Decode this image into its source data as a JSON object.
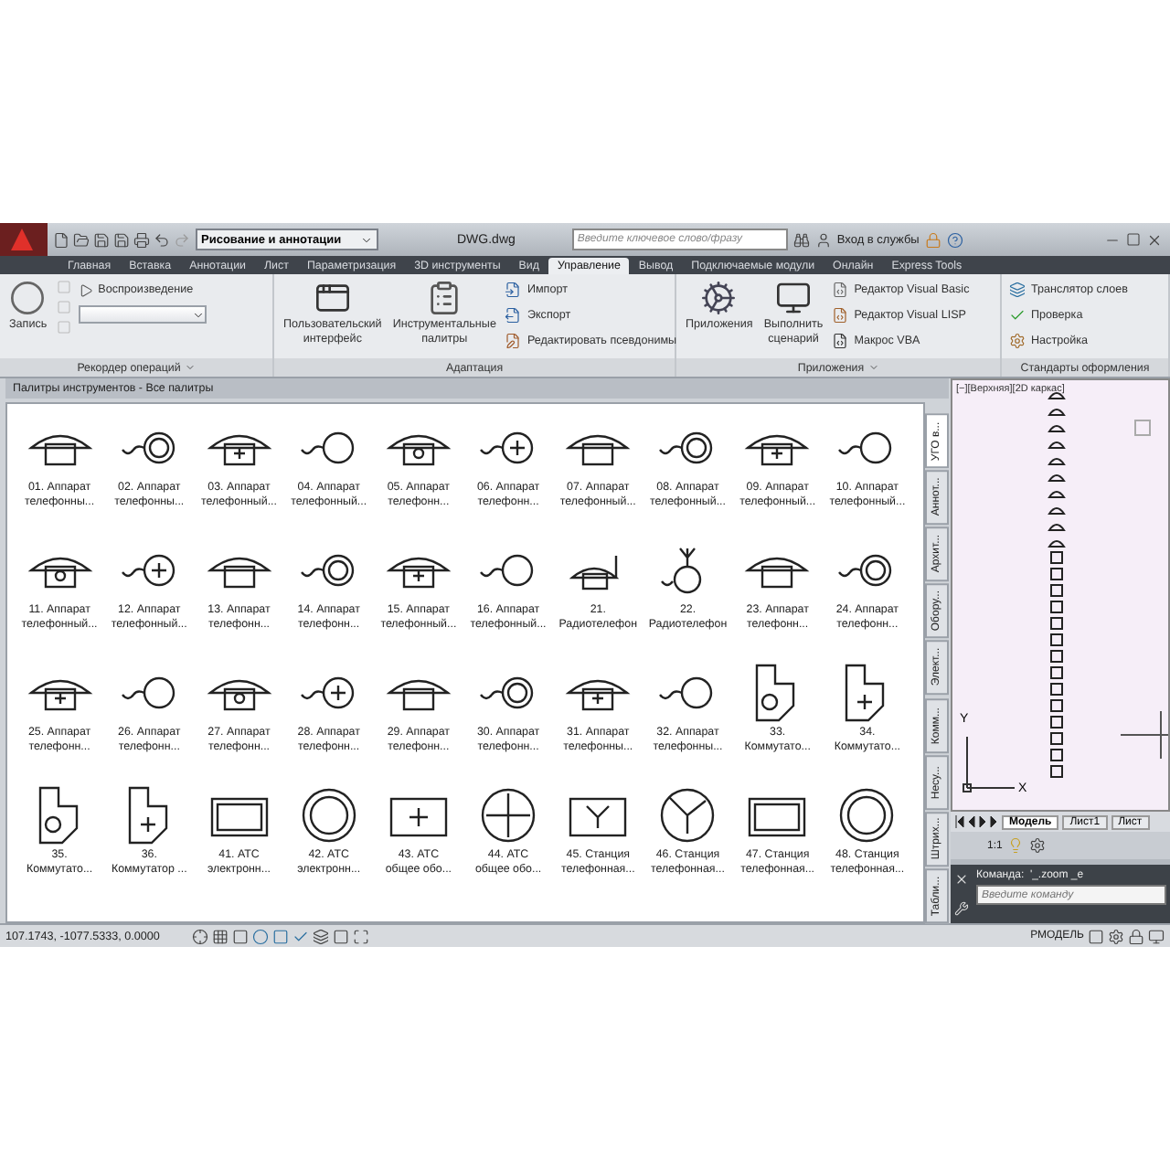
{
  "title_bar": {
    "workspace": "Рисование и аннотации",
    "title": "DWG.dwg",
    "search": {
      "placeholder": "Введите ключевое слово/фразу"
    },
    "sign_in": "Вход в службы"
  },
  "ribbon_tabs": [
    {
      "label": "Главная",
      "selected": false
    },
    {
      "label": "Вставка",
      "selected": false
    },
    {
      "label": "Аннотации",
      "selected": false
    },
    {
      "label": "Лист",
      "selected": false
    },
    {
      "label": "Параметризация",
      "selected": false
    },
    {
      "label": "3D инструменты",
      "selected": false
    },
    {
      "label": "Вид",
      "selected": false
    },
    {
      "label": "Управление",
      "selected": true
    },
    {
      "label": "Вывод",
      "selected": false
    },
    {
      "label": "Подключаемые модули",
      "selected": false
    },
    {
      "label": "Онлайн",
      "selected": false
    },
    {
      "label": "Express Tools",
      "selected": false
    }
  ],
  "ribbon_groups": [
    {
      "title": "Рекордер операций",
      "menu": true,
      "large": [
        {
          "lines": [
            "Запись"
          ]
        }
      ],
      "small": [
        {
          "kind": "play",
          "label": "Воспроизведение"
        },
        {
          "kind": "dropdown"
        }
      ]
    },
    {
      "title": "Адаптация",
      "menu": false,
      "large": [
        {
          "lines": [
            "Пользовательский",
            "интерфейс"
          ]
        },
        {
          "lines": [
            "Инструментальные",
            "палитры"
          ]
        }
      ],
      "small": [
        {
          "kind": "tool",
          "label": "Импорт"
        },
        {
          "kind": "tool",
          "label": "Экспорт"
        },
        {
          "kind": "tool",
          "label": "Редактировать псевдонимы"
        }
      ]
    },
    {
      "title": "Приложения",
      "menu": true,
      "large": [
        {
          "lines": [
            "Приложения"
          ]
        },
        {
          "lines": [
            "Выполнить",
            "сценарий"
          ]
        }
      ],
      "small": [
        {
          "kind": "tool",
          "label": "Редактор Visual Basic"
        },
        {
          "kind": "tool",
          "label": "Редактор Visual LISP"
        },
        {
          "kind": "tool",
          "label": "Макрос VBA"
        }
      ]
    },
    {
      "title": "Стандарты оформления",
      "menu": false,
      "small": [
        {
          "kind": "tool",
          "label": "Транслятор  слоев"
        },
        {
          "kind": "tool",
          "label": "Проверка"
        },
        {
          "kind": "tool",
          "label": "Настройка"
        }
      ]
    }
  ],
  "palette": {
    "title": "Палитры инструментов - Все палитры",
    "items": [
      {
        "kind": "phone",
        "lines": [
          "01. Аппарат",
          "телефонны..."
        ]
      },
      {
        "kind": "handset",
        "lines": [
          "02. Аппарат",
          "телефонны..."
        ]
      },
      {
        "kind": "phone",
        "lines": [
          "03. Аппарат",
          "телефонный..."
        ]
      },
      {
        "kind": "handset",
        "lines": [
          "04. Аппарат",
          "телефонный..."
        ]
      },
      {
        "kind": "phone",
        "lines": [
          "05. Аппарат",
          "телефонн..."
        ]
      },
      {
        "kind": "handset",
        "lines": [
          "06. Аппарат",
          "телефонн..."
        ]
      },
      {
        "kind": "phone",
        "lines": [
          "07. Аппарат",
          "телефонный..."
        ]
      },
      {
        "kind": "handset",
        "lines": [
          "08. Аппарат",
          "телефонный..."
        ]
      },
      {
        "kind": "phone",
        "lines": [
          "09. Аппарат",
          "телефонный..."
        ]
      },
      {
        "kind": "handset",
        "lines": [
          "10. Аппарат",
          "телефонный..."
        ]
      },
      {
        "kind": "phone",
        "lines": [
          "11. Аппарат",
          "телефонный..."
        ]
      },
      {
        "kind": "handset",
        "lines": [
          "12. Аппарат",
          "телефонный..."
        ]
      },
      {
        "kind": "phone",
        "lines": [
          "13. Аппарат",
          "телефонн..."
        ]
      },
      {
        "kind": "handset",
        "lines": [
          "14. Аппарат",
          "телефонн..."
        ]
      },
      {
        "kind": "phone",
        "lines": [
          "15. Аппарат",
          "телефонный..."
        ]
      },
      {
        "kind": "handset",
        "lines": [
          "16. Аппарат",
          "телефонный..."
        ]
      },
      {
        "kind": "radio",
        "lines": [
          "21.",
          "Радиотелефон"
        ]
      },
      {
        "kind": "radio-handset",
        "lines": [
          "22.",
          "Радиотелефон"
        ]
      },
      {
        "kind": "phone",
        "lines": [
          "23. Аппарат",
          "телефонн..."
        ]
      },
      {
        "kind": "handset",
        "lines": [
          "24. Аппарат",
          "телефонн..."
        ]
      },
      {
        "kind": "phone",
        "lines": [
          "25. Аппарат",
          "телефонн..."
        ]
      },
      {
        "kind": "handset",
        "lines": [
          "26. Аппарат",
          "телефонн..."
        ]
      },
      {
        "kind": "phone",
        "lines": [
          "27. Аппарат",
          "телефонн..."
        ]
      },
      {
        "kind": "handset",
        "lines": [
          "28. Аппарат",
          "телефонн..."
        ]
      },
      {
        "kind": "phone",
        "lines": [
          "29. Аппарат",
          "телефонн..."
        ]
      },
      {
        "kind": "handset",
        "lines": [
          "30. Аппарат",
          "телефонн..."
        ]
      },
      {
        "kind": "phone",
        "lines": [
          "31. Аппарат",
          "телефонны..."
        ]
      },
      {
        "kind": "handset",
        "lines": [
          "32. Аппарат",
          "телефонны..."
        ]
      },
      {
        "kind": "switch",
        "lines": [
          "33.",
          "Коммутато..."
        ]
      },
      {
        "kind": "switch",
        "lines": [
          "34.",
          "Коммутато..."
        ]
      },
      {
        "kind": "switch",
        "lines": [
          "35.",
          "Коммутато..."
        ]
      },
      {
        "kind": "switch",
        "lines": [
          "36.",
          "Коммутатор ..."
        ]
      },
      {
        "kind": "rect",
        "lines": [
          "41. АТС",
          "электронн..."
        ]
      },
      {
        "kind": "circle",
        "lines": [
          "42. АТС",
          "электронн..."
        ]
      },
      {
        "kind": "rect",
        "lines": [
          "43. АТС",
          "общее обо..."
        ]
      },
      {
        "kind": "circle",
        "lines": [
          "44. АТС",
          "общее обо..."
        ]
      },
      {
        "kind": "rect",
        "lines": [
          "45. Станция",
          "телефонная..."
        ]
      },
      {
        "kind": "circle",
        "lines": [
          "46. Станция",
          "телефонная..."
        ]
      },
      {
        "kind": "rect",
        "lines": [
          "47. Станция",
          "телефонная..."
        ]
      },
      {
        "kind": "circle",
        "lines": [
          "48. Станция",
          "телефонная..."
        ]
      }
    ],
    "tabs": [
      {
        "label": "УГО в...",
        "selected": true
      },
      {
        "label": "Аннот...",
        "selected": false
      },
      {
        "label": "Архит...",
        "selected": false
      },
      {
        "label": "Обору...",
        "selected": false
      },
      {
        "label": "Элект...",
        "selected": false
      },
      {
        "label": "Комм...",
        "selected": false
      },
      {
        "label": "Несу...",
        "selected": false
      },
      {
        "label": "Штрих...",
        "selected": false
      },
      {
        "label": "Табли...",
        "selected": false
      }
    ]
  },
  "viewport": {
    "label": "[−][Верхняя][2D каркас]",
    "ucs": {
      "x": "X",
      "y": "Y"
    },
    "layout_tabs": [
      {
        "label": "Модель",
        "selected": true
      },
      {
        "label": "Лист1",
        "selected": false
      },
      {
        "label": "Лист",
        "selected": false
      }
    ],
    "scale": "1:1"
  },
  "command": {
    "history": "Команда:  '_.zoom _e",
    "placeholder": "Введите команду"
  },
  "status_bar": {
    "coordinates": "107.1743, -1077.5333, 0.0000",
    "space": "РМОДЕЛЬ"
  }
}
